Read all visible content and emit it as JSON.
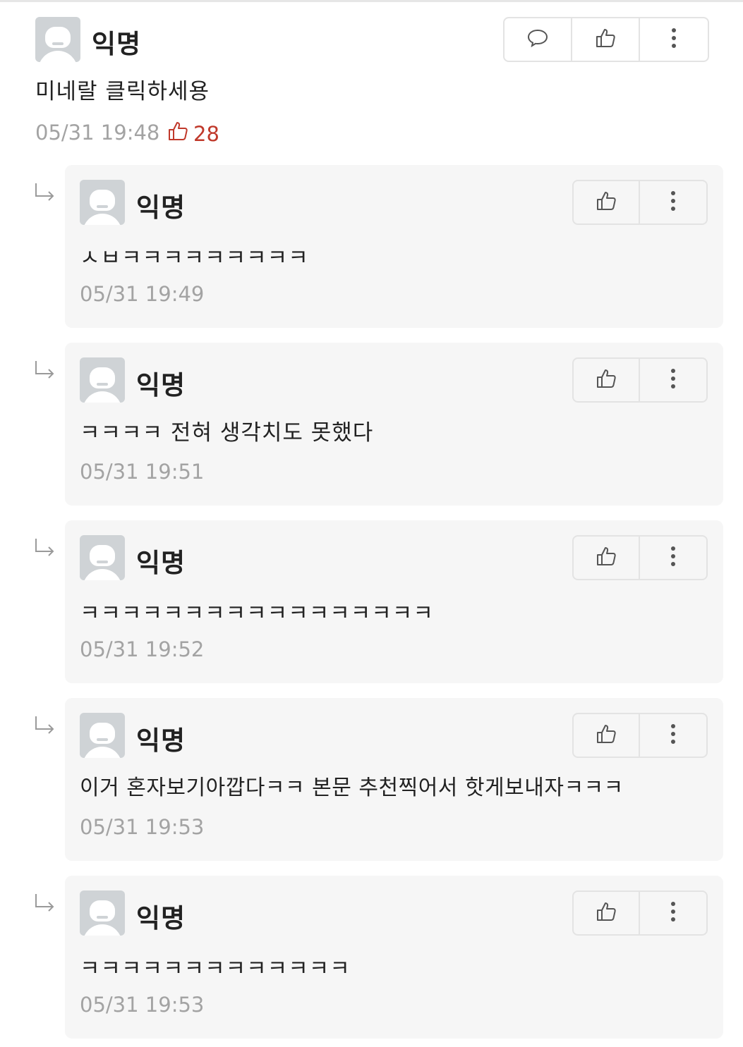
{
  "comment": {
    "author": "익명",
    "text": "미네랄 클릭하세용",
    "time": "05/31 19:48",
    "votes": "28",
    "actions": [
      "chat-bubble-icon",
      "thumbs-up-icon",
      "more-vertical-icon"
    ]
  },
  "replies": [
    {
      "author": "익명",
      "text": "ㅅㅂㅋㅋㅋㅋㅋㅋㅋㅋㅋ",
      "time": "05/31 19:49"
    },
    {
      "author": "익명",
      "text": "ㅋㅋㅋㅋ 전혀 생각치도 못했다",
      "time": "05/31 19:51"
    },
    {
      "author": "익명",
      "text": "ㅋㅋㅋㅋㅋㅋㅋㅋㅋㅋㅋㅋㅋㅋㅋㅋㅋ",
      "time": "05/31 19:52"
    },
    {
      "author": "익명",
      "text": "이거 혼자보기아깝다ㅋㅋ 본문 추천찍어서 핫게보내자ㅋㅋㅋ",
      "time": "05/31 19:53"
    },
    {
      "author": "익명",
      "text": "ㅋㅋㅋㅋㅋㅋㅋㅋㅋㅋㅋㅋㅋ",
      "time": "05/31 19:53"
    }
  ],
  "colors": {
    "accent_red": "#c0392b",
    "reply_bg": "#f6f6f6",
    "muted": "#a3a3a3",
    "avatar": "#cfd3d6"
  }
}
